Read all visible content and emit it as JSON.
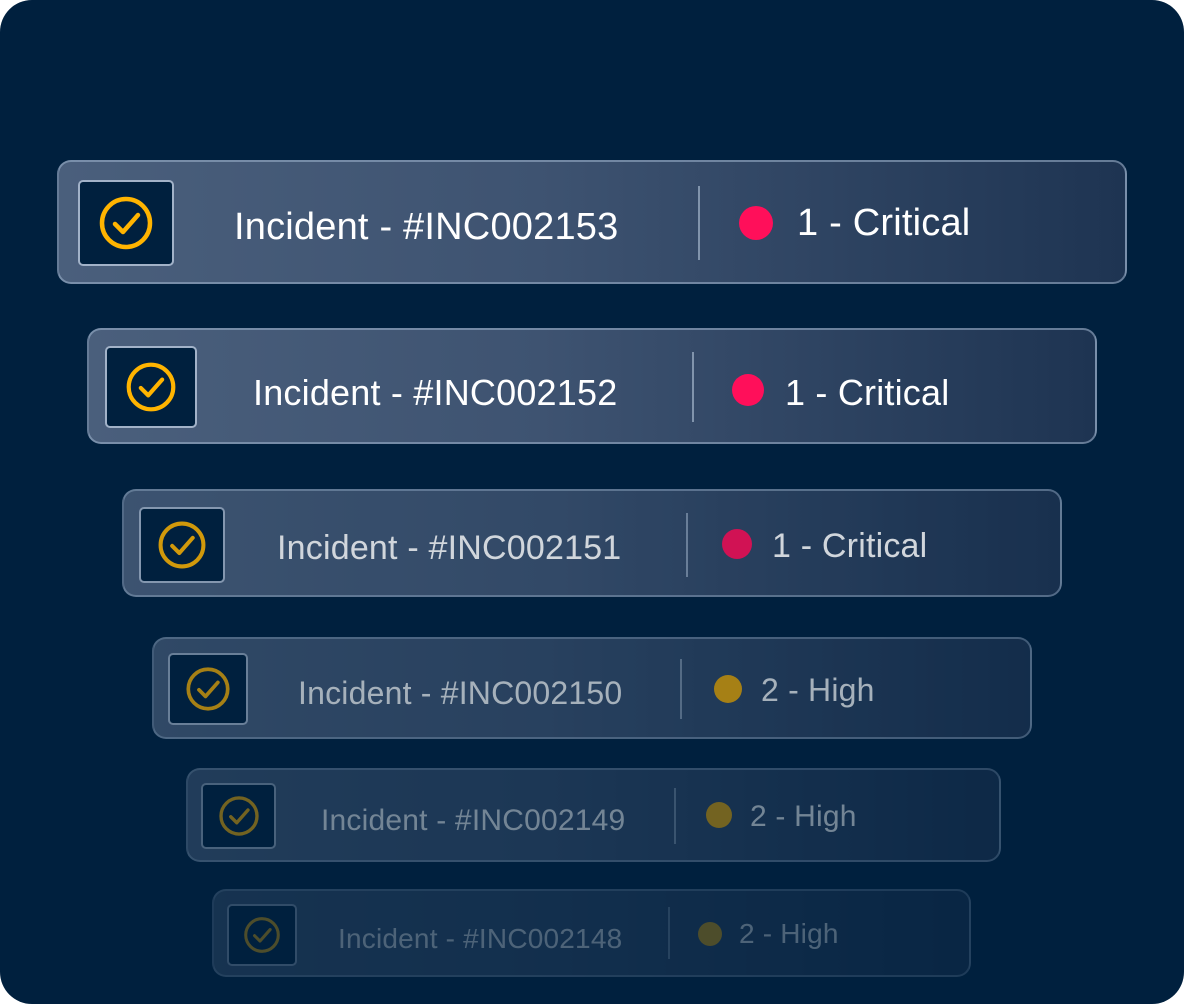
{
  "colors": {
    "background": "#00203e",
    "critical": "#ff0f5a",
    "high": "#b88a00",
    "check_icon": "#ffb400"
  },
  "incidents": [
    {
      "title": "Incident - #INC002153",
      "priority": "1 - Critical",
      "priority_color": "#ff0f5a",
      "icon": "check-circle-icon"
    },
    {
      "title": "Incident - #INC002152",
      "priority": "1 - Critical",
      "priority_color": "#ff0f5a",
      "icon": "check-circle-icon"
    },
    {
      "title": "Incident - #INC002151",
      "priority": "1 - Critical",
      "priority_color": "#ff0f5a",
      "icon": "check-circle-icon"
    },
    {
      "title": "Incident - #INC002150",
      "priority": "2 - High",
      "priority_color": "#b88a00",
      "icon": "check-circle-icon"
    },
    {
      "title": "Incident - #INC002149",
      "priority": "2 - High",
      "priority_color": "#b88a00",
      "icon": "check-circle-icon"
    },
    {
      "title": "Incident - #INC002148",
      "priority": "2 - High",
      "priority_color": "#b88a00",
      "icon": "check-circle-icon"
    }
  ]
}
